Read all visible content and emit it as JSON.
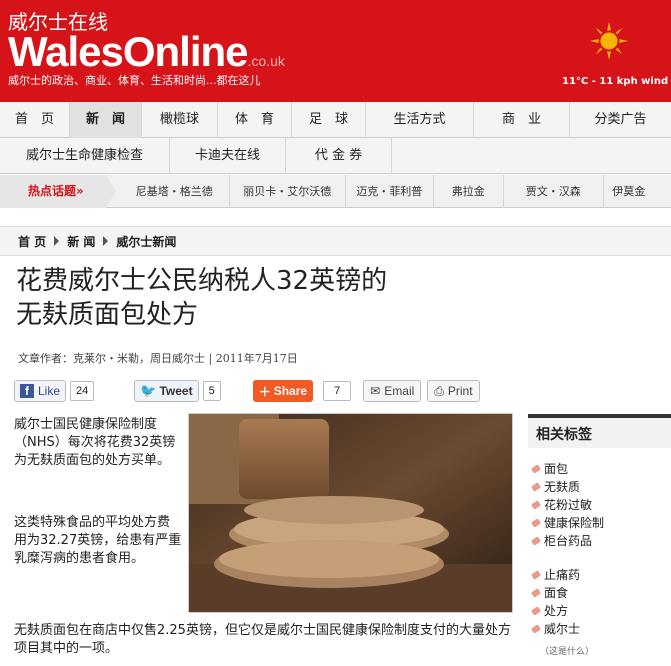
{
  "header": {
    "site_cn": "威尔士在线",
    "logo": "WalesOnline",
    "logo_domain": ".co.uk",
    "tagline": "威尔士的政治、商业、体育、生活和时尚...都在这儿",
    "weather": "11°C - 11 kph wind",
    "weather_icon": "sun-icon"
  },
  "nav_main": [
    "首　页",
    "新　闻",
    "橄榄球",
    "体　育",
    "足　球",
    "生活方式",
    "商　业",
    "分类广告"
  ],
  "nav_main_active": "新　闻",
  "nav_sub": [
    "威尔士生命健康检查",
    "卡迪夫在线",
    "代 金 券"
  ],
  "hot_topics": {
    "label": "热点话题»",
    "items": [
      "尼基塔・格兰德",
      "丽贝卡・艾尔沃德",
      "迈克・菲利普",
      "弗拉金",
      "贾文・汉森",
      "伊莫金"
    ]
  },
  "breadcrumb": [
    "首 页",
    "新 闻",
    "威尔士新闻"
  ],
  "article": {
    "title_line1": "花费威尔士公民纳税人32英镑的",
    "title_line2": "无麸质面包处方",
    "byline": "文章作者：克莱尔・米勒，周日威尔士 | 2011年7月17日",
    "para1": "威尔士国民健康保险制度（NHS）每次将花费32英镑为无麸质面包的处方买单。",
    "para2": "这类特殊食品的平均处方费用为32.27英镑，给患有严重乳糜泻病的患者食用。",
    "para3": "无麸质面包在商店中仅售2.25英镑，但它仅是威尔士国民健康保险制度支付的大量处方项目其中的一项。"
  },
  "share": {
    "like_label": "Like",
    "like_count": "24",
    "tweet_label": "Tweet",
    "tweet_count": "5",
    "share_label": "Share",
    "share_count": "7",
    "email_label": "Email",
    "print_label": "Print"
  },
  "sidebar": {
    "title": "相关标签",
    "tags_group1": [
      "面包",
      "无麸质",
      "花粉过敏",
      "健康保险制",
      "柜台药品"
    ],
    "tags_group2": [
      "止痛药",
      "面食",
      "处方",
      "威尔士"
    ],
    "what_link": "（这是什么）"
  },
  "colors": {
    "brand_red": "#d7131a",
    "share_orange": "#f05a24"
  }
}
